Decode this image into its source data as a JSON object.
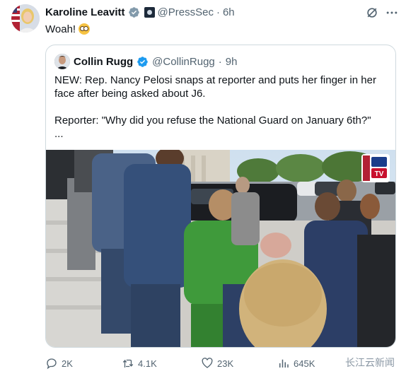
{
  "author": {
    "name": "Karoline Leavitt",
    "handle": "@PressSec",
    "separator": "·",
    "time": "6h",
    "avatar_icon": "avatar-photo"
  },
  "tweet_text": "Woah!",
  "tweet_emoji": "flushed-face-emoji",
  "quoted": {
    "name": "Collin Rugg",
    "handle": "@CollinRugg",
    "separator": "·",
    "time": "9h",
    "text_line1": "NEW: Rep. Nancy Pelosi snaps at reporter and puts her finger in her face after being asked about J6.",
    "text_line2": "Reporter: \"Why did you refuse the National Guard on January 6th?\"",
    "text_line3": "...",
    "media_badge": "TV"
  },
  "actions": {
    "replies": "2K",
    "reposts": "4.1K",
    "likes": "23K",
    "views": "645K"
  },
  "watermark": "长江云新闻",
  "colors": {
    "verified": "#1d9bf0",
    "text_primary": "#0f1419",
    "text_secondary": "#536471",
    "border": "#cfd9de"
  }
}
